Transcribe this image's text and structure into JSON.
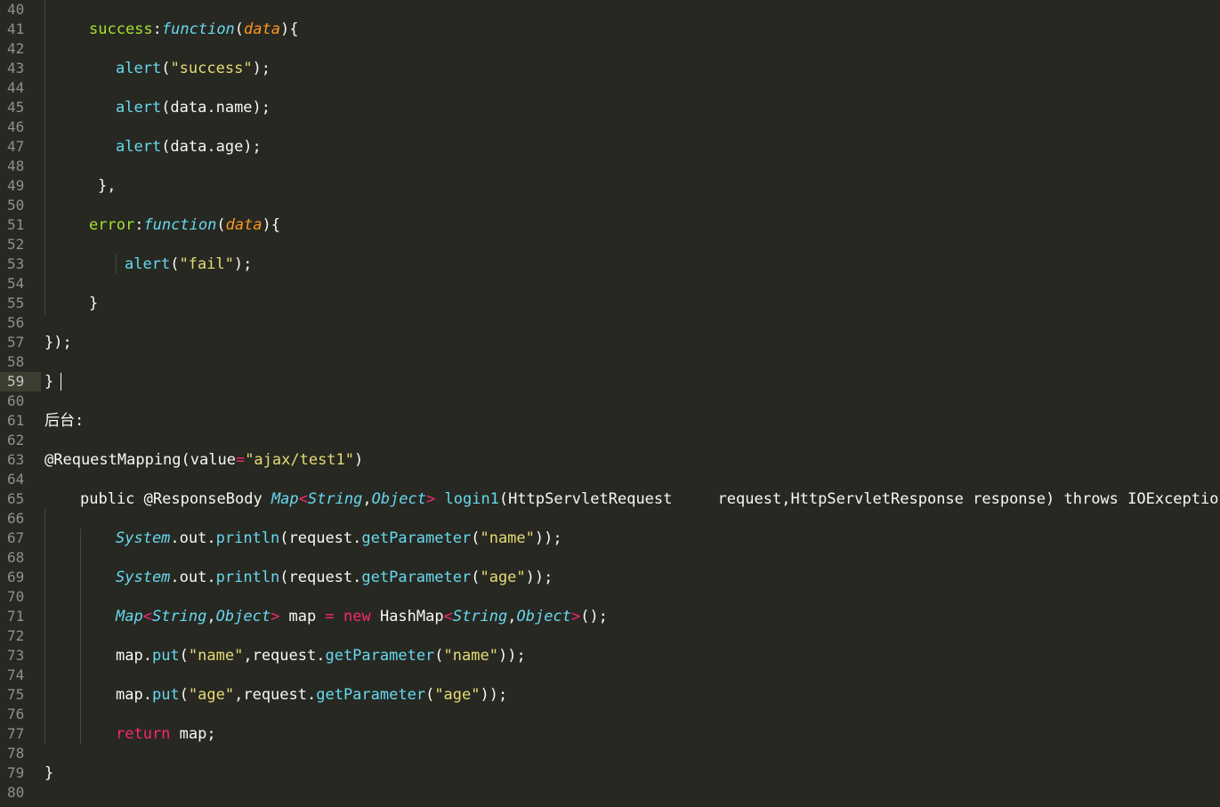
{
  "editor": {
    "theme_colors": {
      "background": "#272822",
      "text": "#f8f8f2",
      "keyword": "#f92672",
      "function": "#66d9ef",
      "string": "#e6db74",
      "property": "#a6e22e",
      "parameter": "#fd971f"
    },
    "current_line": 59,
    "lines": [
      {
        "n": "40",
        "indent": 0,
        "tokens": []
      },
      {
        "n": "41",
        "indent": 100,
        "tokens": [
          {
            "t": "success",
            "c": "prop"
          },
          {
            "t": ":",
            "c": "pl"
          },
          {
            "t": "function",
            "c": "it"
          },
          {
            "t": "(",
            "c": "pl"
          },
          {
            "t": "data",
            "c": "par"
          },
          {
            "t": "){",
            "c": "pl"
          }
        ]
      },
      {
        "n": "42",
        "indent": 0,
        "tokens": []
      },
      {
        "n": "43",
        "indent": 130,
        "tokens": [
          {
            "t": "alert",
            "c": "fn"
          },
          {
            "t": "(",
            "c": "pl"
          },
          {
            "t": "\"success\"",
            "c": "str"
          },
          {
            "t": ");",
            "c": "pl"
          }
        ]
      },
      {
        "n": "44",
        "indent": 0,
        "tokens": []
      },
      {
        "n": "45",
        "indent": 130,
        "tokens": [
          {
            "t": "alert",
            "c": "fn"
          },
          {
            "t": "(data.name);",
            "c": "pl"
          }
        ]
      },
      {
        "n": "46",
        "indent": 0,
        "tokens": []
      },
      {
        "n": "47",
        "indent": 130,
        "tokens": [
          {
            "t": "alert",
            "c": "fn"
          },
          {
            "t": "(data.age);",
            "c": "pl"
          }
        ]
      },
      {
        "n": "48",
        "indent": 0,
        "tokens": []
      },
      {
        "n": "49",
        "indent": 110,
        "tokens": [
          {
            "t": "},",
            "c": "pl"
          }
        ]
      },
      {
        "n": "50",
        "indent": 0,
        "tokens": []
      },
      {
        "n": "51",
        "indent": 100,
        "tokens": [
          {
            "t": "error",
            "c": "prop"
          },
          {
            "t": ":",
            "c": "pl"
          },
          {
            "t": "function",
            "c": "it"
          },
          {
            "t": "(",
            "c": "pl"
          },
          {
            "t": "data",
            "c": "par"
          },
          {
            "t": "){",
            "c": "pl"
          }
        ]
      },
      {
        "n": "52",
        "indent": 0,
        "tokens": []
      },
      {
        "n": "53",
        "indent": 140,
        "tokens": [
          {
            "t": "alert",
            "c": "fn"
          },
          {
            "t": "(",
            "c": "pl"
          },
          {
            "t": "\"fail\"",
            "c": "str"
          },
          {
            "t": ");",
            "c": "pl"
          }
        ]
      },
      {
        "n": "54",
        "indent": 0,
        "tokens": []
      },
      {
        "n": "55",
        "indent": 100,
        "tokens": [
          {
            "t": "}",
            "c": "pl"
          }
        ]
      },
      {
        "n": "56",
        "indent": 0,
        "tokens": []
      },
      {
        "n": "57",
        "indent": 50,
        "tokens": [
          {
            "t": "});",
            "c": "pl"
          }
        ]
      },
      {
        "n": "58",
        "indent": 0,
        "tokens": []
      },
      {
        "n": "59",
        "indent": 50,
        "tokens": [
          {
            "t": "}",
            "c": "pl"
          }
        ]
      },
      {
        "n": "60",
        "indent": 0,
        "tokens": []
      },
      {
        "n": "61",
        "indent": 50,
        "tokens": [
          {
            "t": "后台:",
            "c": "pl"
          }
        ]
      },
      {
        "n": "62",
        "indent": 0,
        "tokens": []
      },
      {
        "n": "63",
        "indent": 50,
        "tokens": [
          {
            "t": "@RequestMapping(value",
            "c": "pl"
          },
          {
            "t": "=",
            "c": "op"
          },
          {
            "t": "\"ajax/test1\"",
            "c": "str"
          },
          {
            "t": ")",
            "c": "pl"
          }
        ]
      },
      {
        "n": "64",
        "indent": 0,
        "tokens": []
      },
      {
        "n": "65",
        "indent": 90,
        "tokens": [
          {
            "t": "public @ResponseBody ",
            "c": "pl"
          },
          {
            "t": "Map",
            "c": "it"
          },
          {
            "t": "<",
            "c": "op"
          },
          {
            "t": "String",
            "c": "it"
          },
          {
            "t": ",",
            "c": "pl"
          },
          {
            "t": "Object",
            "c": "it"
          },
          {
            "t": ">",
            "c": "op"
          },
          {
            "t": " ",
            "c": "pl"
          },
          {
            "t": "login1",
            "c": "fn"
          },
          {
            "t": "(HttpServletRequest     request,HttpServletResponse response) throws IOException{",
            "c": "pl"
          }
        ]
      },
      {
        "n": "66",
        "indent": 0,
        "tokens": []
      },
      {
        "n": "67",
        "indent": 130,
        "tokens": [
          {
            "t": "System",
            "c": "it"
          },
          {
            "t": ".out.",
            "c": "pl"
          },
          {
            "t": "println",
            "c": "fn"
          },
          {
            "t": "(request.",
            "c": "pl"
          },
          {
            "t": "getParameter",
            "c": "fn"
          },
          {
            "t": "(",
            "c": "pl"
          },
          {
            "t": "\"name\"",
            "c": "str"
          },
          {
            "t": "));",
            "c": "pl"
          }
        ]
      },
      {
        "n": "68",
        "indent": 0,
        "tokens": []
      },
      {
        "n": "69",
        "indent": 130,
        "tokens": [
          {
            "t": "System",
            "c": "it"
          },
          {
            "t": ".out.",
            "c": "pl"
          },
          {
            "t": "println",
            "c": "fn"
          },
          {
            "t": "(request.",
            "c": "pl"
          },
          {
            "t": "getParameter",
            "c": "fn"
          },
          {
            "t": "(",
            "c": "pl"
          },
          {
            "t": "\"age\"",
            "c": "str"
          },
          {
            "t": "));",
            "c": "pl"
          }
        ]
      },
      {
        "n": "70",
        "indent": 0,
        "tokens": []
      },
      {
        "n": "71",
        "indent": 130,
        "tokens": [
          {
            "t": "Map",
            "c": "it"
          },
          {
            "t": "<",
            "c": "op"
          },
          {
            "t": "String",
            "c": "it"
          },
          {
            "t": ",",
            "c": "pl"
          },
          {
            "t": "Object",
            "c": "it"
          },
          {
            "t": ">",
            "c": "op"
          },
          {
            "t": " map ",
            "c": "pl"
          },
          {
            "t": "=",
            "c": "op"
          },
          {
            "t": " ",
            "c": "pl"
          },
          {
            "t": "new",
            "c": "kw"
          },
          {
            "t": " HashMap",
            "c": "pl"
          },
          {
            "t": "<",
            "c": "op"
          },
          {
            "t": "String",
            "c": "it"
          },
          {
            "t": ",",
            "c": "pl"
          },
          {
            "t": "Object",
            "c": "it"
          },
          {
            "t": ">",
            "c": "op"
          },
          {
            "t": "();",
            "c": "pl"
          }
        ]
      },
      {
        "n": "72",
        "indent": 0,
        "tokens": []
      },
      {
        "n": "73",
        "indent": 130,
        "tokens": [
          {
            "t": "map.",
            "c": "pl"
          },
          {
            "t": "put",
            "c": "fn"
          },
          {
            "t": "(",
            "c": "pl"
          },
          {
            "t": "\"name\"",
            "c": "str"
          },
          {
            "t": ",request.",
            "c": "pl"
          },
          {
            "t": "getParameter",
            "c": "fn"
          },
          {
            "t": "(",
            "c": "pl"
          },
          {
            "t": "\"name\"",
            "c": "str"
          },
          {
            "t": "));",
            "c": "pl"
          }
        ]
      },
      {
        "n": "74",
        "indent": 0,
        "tokens": []
      },
      {
        "n": "75",
        "indent": 130,
        "tokens": [
          {
            "t": "map.",
            "c": "pl"
          },
          {
            "t": "put",
            "c": "fn"
          },
          {
            "t": "(",
            "c": "pl"
          },
          {
            "t": "\"age\"",
            "c": "str"
          },
          {
            "t": ",request.",
            "c": "pl"
          },
          {
            "t": "getParameter",
            "c": "fn"
          },
          {
            "t": "(",
            "c": "pl"
          },
          {
            "t": "\"age\"",
            "c": "str"
          },
          {
            "t": "));",
            "c": "pl"
          }
        ]
      },
      {
        "n": "76",
        "indent": 0,
        "tokens": []
      },
      {
        "n": "77",
        "indent": 130,
        "tokens": [
          {
            "t": "return",
            "c": "kw"
          },
          {
            "t": " map;",
            "c": "pl"
          }
        ]
      },
      {
        "n": "78",
        "indent": 0,
        "tokens": []
      },
      {
        "n": "79",
        "indent": 50,
        "tokens": [
          {
            "t": "}",
            "c": "pl"
          }
        ]
      },
      {
        "n": "80",
        "indent": 0,
        "tokens": []
      }
    ]
  }
}
